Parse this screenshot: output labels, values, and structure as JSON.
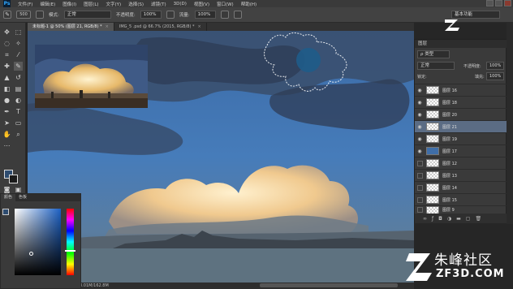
{
  "app": {
    "logo": "Ps"
  },
  "menu": [
    "文件(F)",
    "编辑(E)",
    "图像(I)",
    "图层(L)",
    "文字(Y)",
    "选择(S)",
    "滤镜(T)",
    "3D(D)",
    "视图(V)",
    "窗口(W)",
    "帮助(H)"
  ],
  "options": {
    "brush_size": "500",
    "mode_label": "模式:",
    "mode_value": "正常",
    "opacity_label": "不透明度:",
    "opacity_value": "100%",
    "flow_label": "流量:",
    "flow_value": "100%",
    "workspace": "基本功能"
  },
  "tabs": [
    {
      "label": "未标题-1 @ 50% (图层 21, RGB/8) *",
      "close": "×",
      "active": true
    },
    {
      "label": "IMG_5 .psd @ 66.7% (2015, RGB/8) *",
      "close": "×",
      "active": false
    }
  ],
  "status": {
    "doc_size": "8.01M/162.8M"
  },
  "color_panel": {
    "tabs": [
      "颜色",
      "色板"
    ]
  },
  "layers_panel": {
    "title": "图层",
    "filter": "ρ 类型",
    "blend_mode": "正常",
    "opacity_label": "不透明度:",
    "opacity_value": "100%",
    "lock_label": "锁定:",
    "fill_label": "填充:",
    "fill_value": "100%",
    "layers": [
      {
        "name": "图层 16",
        "visible": true,
        "selected": false
      },
      {
        "name": "图层 18",
        "visible": true,
        "selected": false
      },
      {
        "name": "图层 20",
        "visible": true,
        "selected": false
      },
      {
        "name": "图层 21",
        "visible": true,
        "selected": true
      },
      {
        "name": "图层 19",
        "visible": true,
        "selected": false
      },
      {
        "name": "图层 17",
        "visible": true,
        "selected": false
      },
      {
        "name": "图层 12",
        "visible": false,
        "selected": false
      },
      {
        "name": "图层 13",
        "visible": false,
        "selected": false
      },
      {
        "name": "图层 14",
        "visible": false,
        "selected": false
      },
      {
        "name": "图层 15",
        "visible": false,
        "selected": false
      },
      {
        "name": "图层 9",
        "visible": false,
        "selected": false
      }
    ]
  },
  "watermark": {
    "site": "朱峰社区",
    "domain": "ZF3D.COM"
  },
  "colors": {
    "accent": "#31a8ff",
    "fg": "#2e4c70",
    "bg": "#1b1b1b",
    "selected_layer": "#5b6c84"
  }
}
